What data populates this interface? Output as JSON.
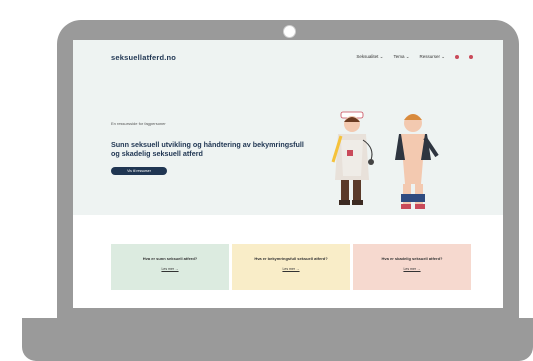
{
  "site": {
    "logo": "seksuellatferd.no",
    "nav": [
      {
        "label": "Seksualitet ⌄"
      },
      {
        "label": "Tema ⌄"
      },
      {
        "label": "Ressurser ⌄"
      }
    ],
    "nav_dot_colors": [
      "#c94a5a",
      "#c94a5a"
    ]
  },
  "hero": {
    "eyebrow": "En ressursside for fagpersoner",
    "headline": "Sunn seksuell utvikling og håndtering av bekymringsfull og skadelig seksuell atferd",
    "cta_label": "Vis til ressurser"
  },
  "cards": [
    {
      "title": "Hva er sunn seksuell atferd?",
      "link": "Les mer →",
      "color": "#dcebe0"
    },
    {
      "title": "Hva er bekymringsfull seksuell atferd?",
      "link": "Les mer →",
      "color": "#f9edc8"
    },
    {
      "title": "Hva er skadelig seksuell atferd?",
      "link": "Les mer →",
      "color": "#f6d9cf"
    }
  ],
  "colors": {
    "laptop": "#9a9a9a",
    "hero_bg": "#eef3f2",
    "brand": "#1f3552"
  }
}
